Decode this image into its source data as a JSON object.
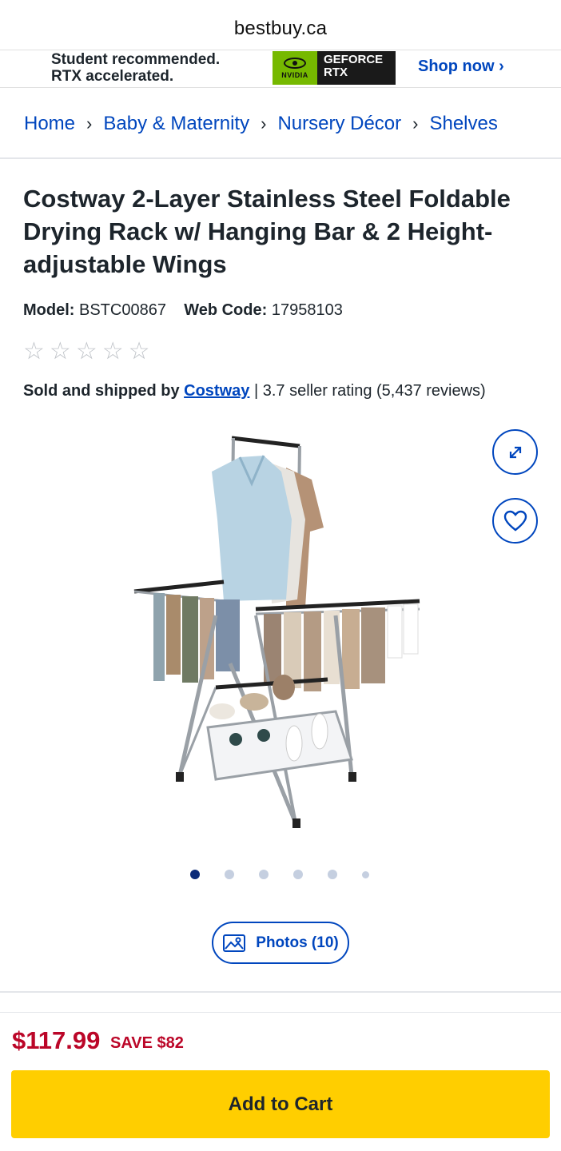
{
  "browser": {
    "url": "bestbuy.ca"
  },
  "promo": {
    "line1": "Student recommended.",
    "line2": "RTX accelerated.",
    "badge_brand": "NVIDIA",
    "badge_line1": "GEFORCE",
    "badge_line2": "RTX",
    "cta": "Shop now ›"
  },
  "breadcrumb": {
    "items": [
      "Home",
      "Baby & Maternity",
      "Nursery Décor",
      "Shelves"
    ],
    "separator": ">"
  },
  "product": {
    "title": "Costway 2-Layer Stainless Steel Foldable Drying Rack w/ Hanging Bar & 2 Height-adjustable Wings",
    "model_label": "Model:",
    "model_value": "BSTC00867",
    "webcode_label": "Web Code:",
    "webcode_value": "17958103",
    "rating_stars": 0,
    "rating_max": 5,
    "sold_by_prefix": "Sold and shipped by",
    "seller": "Costway",
    "seller_rating": "| 3.7 seller rating (5,437 reviews)"
  },
  "gallery": {
    "image_count": 6,
    "active_index": 0,
    "photos_button": "Photos (10)"
  },
  "pricing": {
    "price": "$117.99",
    "save": "SAVE $82"
  },
  "actions": {
    "add_to_cart": "Add to Cart"
  },
  "colors": {
    "brand_blue": "#0046be",
    "price_red": "#bb0628",
    "cart_yellow": "#ffce00",
    "nvidia_green": "#76b900"
  },
  "icons": [
    "expand-icon",
    "heart-icon",
    "image-icon",
    "star-outline-icon",
    "chevron-right-icon"
  ]
}
